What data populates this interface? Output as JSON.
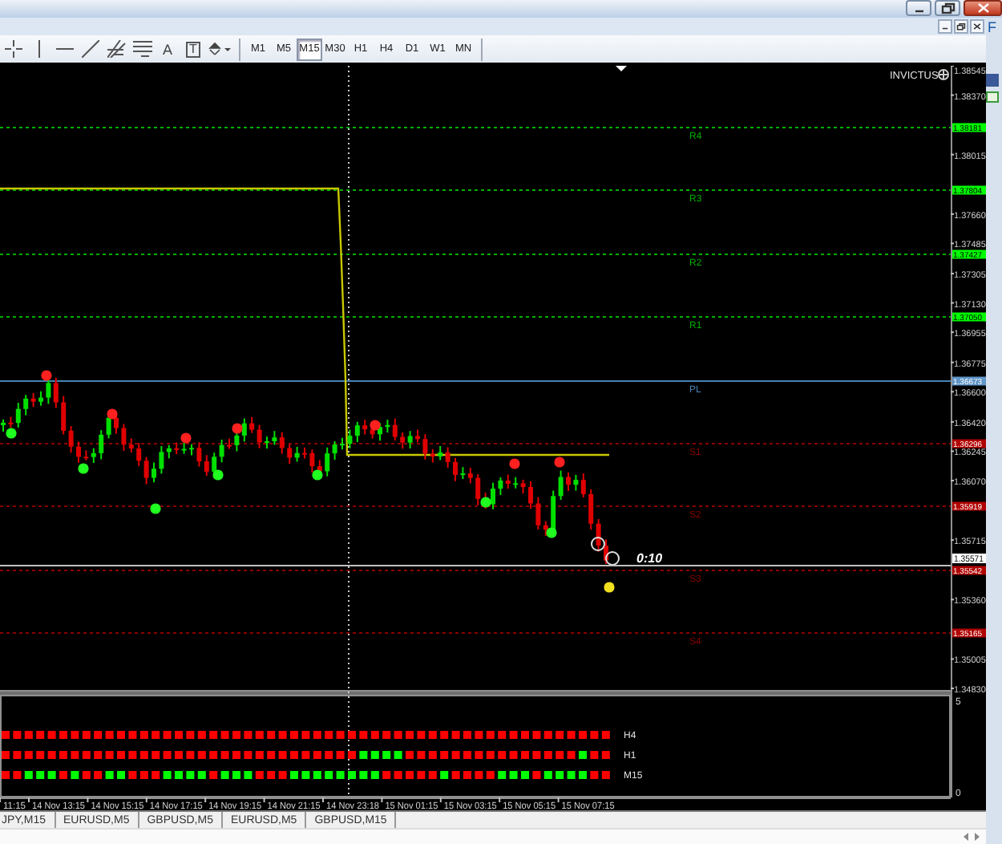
{
  "toolbar": {
    "tools": [
      {
        "kind": "crosshair"
      },
      {
        "kind": "vline"
      },
      {
        "kind": "hline"
      },
      {
        "kind": "trend"
      },
      {
        "kind": "fibo"
      },
      {
        "kind": "channel"
      },
      {
        "kind": "text",
        "glyph": "A"
      },
      {
        "kind": "label",
        "glyph": "T"
      },
      {
        "kind": "arrows"
      }
    ],
    "timeframes": [
      {
        "label": "M1",
        "selected": false
      },
      {
        "label": "M5",
        "selected": false
      },
      {
        "label": "M15",
        "selected": true
      },
      {
        "label": "M30",
        "selected": false
      },
      {
        "label": "H1",
        "selected": false
      },
      {
        "label": "H4",
        "selected": false
      },
      {
        "label": "D1",
        "selected": false
      },
      {
        "label": "W1",
        "selected": false
      },
      {
        "label": "MN",
        "selected": false
      }
    ]
  },
  "side_panel": {
    "text": "F"
  },
  "chart": {
    "indicator_name": "INVICTUS",
    "price_ticks": [
      "1.38545",
      "1.38370",
      "1.38015",
      "1.37660",
      "1.37485",
      "1.37305",
      "1.37130",
      "1.36955",
      "1.36775",
      "1.36600",
      "1.36420",
      "1.36245",
      "1.36070",
      "1.35715",
      "1.35360",
      "1.35005",
      "1.34830"
    ],
    "pivots": [
      {
        "label": "R4",
        "price": "1.38181",
        "kind": "resistance"
      },
      {
        "label": "R3",
        "price": "1.37804",
        "kind": "resistance"
      },
      {
        "label": "R2",
        "price": "1.37427",
        "kind": "resistance"
      },
      {
        "label": "R1",
        "price": "1.37050",
        "kind": "resistance"
      },
      {
        "label": "PL",
        "price": "1.36673",
        "kind": "pivot"
      },
      {
        "label": "S1",
        "price": "1.36296",
        "kind": "support"
      },
      {
        "label": "S2",
        "price": "1.35919",
        "kind": "support"
      },
      {
        "label": "S3",
        "price": "1.35542",
        "kind": "support"
      },
      {
        "label": "S4",
        "price": "1.35165",
        "kind": "support"
      }
    ],
    "current": {
      "price": "1.35571",
      "timer": "0:10"
    },
    "time_labels": [
      "11:15",
      "14 Nov 13:15",
      "14 Nov 15:15",
      "14 Nov 17:15",
      "14 Nov 19:15",
      "14 Nov 21:15",
      "14 Nov 23:18",
      "15 Nov 01:15",
      "15 Nov 03:15",
      "15 Nov 05:15",
      "15 Nov 07:15"
    ],
    "subwindow": {
      "scale_max": "5",
      "scale_min": "0",
      "rows": [
        {
          "label": "H4",
          "dots": [
            {
              "color": "#ff0000"
            },
            {
              "color": "#ff0000"
            },
            {
              "color": "#ff0000"
            },
            {
              "color": "#ff0000"
            },
            {
              "color": "#ff0000"
            },
            {
              "color": "#ff0000"
            },
            {
              "color": "#ff0000"
            },
            {
              "color": "#ff0000"
            },
            {
              "color": "#ff0000"
            },
            {
              "color": "#ff0000"
            },
            {
              "color": "#ff0000"
            },
            {
              "color": "#ff0000"
            },
            {
              "color": "#ff0000"
            },
            {
              "color": "#ff0000"
            },
            {
              "color": "#ff0000"
            },
            {
              "color": "#ff0000"
            },
            {
              "color": "#ff0000"
            },
            {
              "color": "#ff0000"
            },
            {
              "color": "#ff0000"
            },
            {
              "color": "#ff0000"
            },
            {
              "color": "#ff0000"
            },
            {
              "color": "#ff0000"
            },
            {
              "color": "#ff0000"
            },
            {
              "color": "#ff0000"
            },
            {
              "color": "#ff0000"
            },
            {
              "color": "#ff0000"
            },
            {
              "color": "#ff0000"
            },
            {
              "color": "#ff0000"
            },
            {
              "color": "#ff0000"
            },
            {
              "color": "#ff0000"
            },
            {
              "color": "#ff0000"
            },
            {
              "color": "#ff0000"
            },
            {
              "color": "#ff0000"
            },
            {
              "color": "#ff0000"
            },
            {
              "color": "#ff0000"
            },
            {
              "color": "#ff0000"
            },
            {
              "color": "#ff0000"
            },
            {
              "color": "#ff0000"
            },
            {
              "color": "#ff0000"
            },
            {
              "color": "#ff0000"
            },
            {
              "color": "#ff0000"
            },
            {
              "color": "#ff0000"
            },
            {
              "color": "#ff0000"
            },
            {
              "color": "#ff0000"
            },
            {
              "color": "#ff0000"
            },
            {
              "color": "#ff0000"
            },
            {
              "color": "#ff0000"
            },
            {
              "color": "#ff0000"
            },
            {
              "color": "#ff0000"
            },
            {
              "color": "#ff0000"
            },
            {
              "color": "#ff0000"
            },
            {
              "color": "#ff0000"
            },
            {
              "color": "#ff0000"
            }
          ]
        },
        {
          "label": "H1",
          "dots": [
            {
              "color": "#ff0000"
            },
            {
              "color": "#ff0000"
            },
            {
              "color": "#ff0000"
            },
            {
              "color": "#ff0000"
            },
            {
              "color": "#ff0000"
            },
            {
              "color": "#ff0000"
            },
            {
              "color": "#ff0000"
            },
            {
              "color": "#ff0000"
            },
            {
              "color": "#ff0000"
            },
            {
              "color": "#ff0000"
            },
            {
              "color": "#ff0000"
            },
            {
              "color": "#ff0000"
            },
            {
              "color": "#ff0000"
            },
            {
              "color": "#ff0000"
            },
            {
              "color": "#ff0000"
            },
            {
              "color": "#ff0000"
            },
            {
              "color": "#ff0000"
            },
            {
              "color": "#ff0000"
            },
            {
              "color": "#ff0000"
            },
            {
              "color": "#ff0000"
            },
            {
              "color": "#ff0000"
            },
            {
              "color": "#ff0000"
            },
            {
              "color": "#ff0000"
            },
            {
              "color": "#ff0000"
            },
            {
              "color": "#ff0000"
            },
            {
              "color": "#ff0000"
            },
            {
              "color": "#ff0000"
            },
            {
              "color": "#ff0000"
            },
            {
              "color": "#ff0000"
            },
            {
              "color": "#ff0000"
            },
            {
              "color": "#ff0000"
            },
            {
              "color": "#00ff00"
            },
            {
              "color": "#00ff00"
            },
            {
              "color": "#00ff00"
            },
            {
              "color": "#00ff00"
            },
            {
              "color": "#ff0000"
            },
            {
              "color": "#ff0000"
            },
            {
              "color": "#ff0000"
            },
            {
              "color": "#ff0000"
            },
            {
              "color": "#ff0000"
            },
            {
              "color": "#ff0000"
            },
            {
              "color": "#ff0000"
            },
            {
              "color": "#ff0000"
            },
            {
              "color": "#ff0000"
            },
            {
              "color": "#ff0000"
            },
            {
              "color": "#ff0000"
            },
            {
              "color": "#ff0000"
            },
            {
              "color": "#ff0000"
            },
            {
              "color": "#ff0000"
            },
            {
              "color": "#ff0000"
            },
            {
              "color": "#00ff00"
            },
            {
              "color": "#ff0000"
            },
            {
              "color": "#ff0000"
            }
          ]
        },
        {
          "label": "M15",
          "dots": [
            {
              "color": "#ff0000"
            },
            {
              "color": "#ff0000"
            },
            {
              "color": "#00ff00"
            },
            {
              "color": "#00ff00"
            },
            {
              "color": "#00ff00"
            },
            {
              "color": "#ff0000"
            },
            {
              "color": "#00ff00"
            },
            {
              "color": "#ff0000"
            },
            {
              "color": "#ff0000"
            },
            {
              "color": "#00ff00"
            },
            {
              "color": "#00ff00"
            },
            {
              "color": "#ff0000"
            },
            {
              "color": "#ff0000"
            },
            {
              "color": "#ff0000"
            },
            {
              "color": "#00ff00"
            },
            {
              "color": "#00ff00"
            },
            {
              "color": "#00ff00"
            },
            {
              "color": "#00ff00"
            },
            {
              "color": "#ff0000"
            },
            {
              "color": "#00ff00"
            },
            {
              "color": "#00ff00"
            },
            {
              "color": "#00ff00"
            },
            {
              "color": "#ff0000"
            },
            {
              "color": "#ff0000"
            },
            {
              "color": "#ff0000"
            },
            {
              "color": "#00ff00"
            },
            {
              "color": "#00ff00"
            },
            {
              "color": "#00ff00"
            },
            {
              "color": "#00ff00"
            },
            {
              "color": "#00ff00"
            },
            {
              "color": "#00ff00"
            },
            {
              "color": "#00ff00"
            },
            {
              "color": "#00ff00"
            },
            {
              "color": "#ff0000"
            },
            {
              "color": "#ff0000"
            },
            {
              "color": "#ff0000"
            },
            {
              "color": "#ff0000"
            },
            {
              "color": "#ff0000"
            },
            {
              "color": "#00ff00"
            },
            {
              "color": "#ff0000"
            },
            {
              "color": "#ff0000"
            },
            {
              "color": "#ff0000"
            },
            {
              "color": "#ff0000"
            },
            {
              "color": "#00ff00"
            },
            {
              "color": "#00ff00"
            },
            {
              "color": "#00ff00"
            },
            {
              "color": "#ff0000"
            },
            {
              "color": "#00ff00"
            },
            {
              "color": "#00ff00"
            },
            {
              "color": "#00ff00"
            },
            {
              "color": "#00ff00"
            },
            {
              "color": "#ff0000"
            },
            {
              "color": "#ff0000"
            }
          ]
        }
      ]
    }
  },
  "tabs": [
    {
      "label": "JPY,M15"
    },
    {
      "label": "EURUSD,M5"
    },
    {
      "label": "GBPUSD,M5"
    },
    {
      "label": "EURUSD,M5"
    },
    {
      "label": "GBPUSD,M15"
    }
  ]
}
